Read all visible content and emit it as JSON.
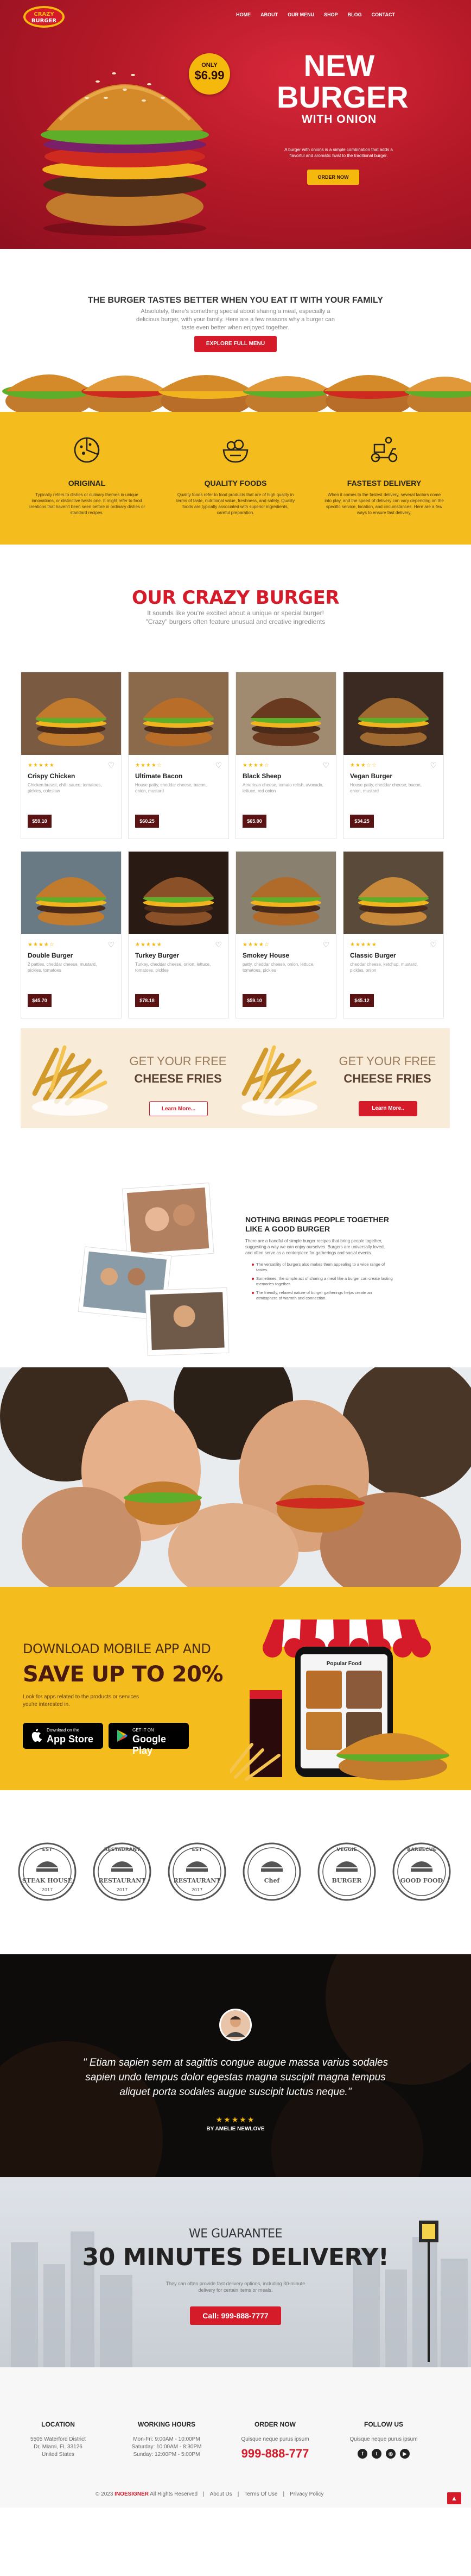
{
  "brand": {
    "logo_text_1": "CRAZY",
    "logo_text_2": "BURGER"
  },
  "nav": [
    {
      "label": "HOME"
    },
    {
      "label": "ABOUT"
    },
    {
      "label": "OUR MENU"
    },
    {
      "label": "SHOP"
    },
    {
      "label": "BLOG"
    },
    {
      "label": "CONTACT"
    }
  ],
  "hero": {
    "price_label": "ONLY",
    "price": "$6.99",
    "title_1": "NEW",
    "title_2": "BURGER",
    "title_3": "WITH ONION",
    "description": "A burger with onions is a simple combination that adds a flavorful and aromatic twist to the traditional burger.",
    "button": "ORDER NOW"
  },
  "intro": {
    "heading": "THE BURGER TASTES BETTER WHEN YOU EAT IT WITH YOUR FAMILY",
    "text": "Absolutely, there's something special about sharing a meal, especially a delicious burger, with your family. Here are a few reasons why a burger can taste even better when enjoyed together.",
    "button": "EXPLORE FULL MENU"
  },
  "features": [
    {
      "icon": "pizza-slice-icon",
      "title": "ORIGINAL",
      "text": "Typically refers to dishes or culinary themes in unique innovations, or distinctive twists one. It might refer to food creations that haven't been seen before in ordinary dishes or standard recipes."
    },
    {
      "icon": "salad-bowl-icon",
      "title": "QUALITY FOODS",
      "text": "Quality foods refer to food products that are of high quality in terms of taste, nutritional value, freshness, and safety. Quality foods are typically associated with superior ingredients, careful preparation."
    },
    {
      "icon": "delivery-scooter-icon",
      "title": "FASTEST DELIVERY",
      "text": "When it comes to the fastest delivery, several factors come into play, and the speed of delivery can vary depending on the specific service, location, and circumstances. Here are a few ways to ensure fast delivery."
    }
  ],
  "menu": {
    "title": "OUR CRAZY BURGER",
    "subtitle_1": "It sounds like you're excited about a unique or special burger!",
    "subtitle_2": "\"Crazy\" burgers often feature unusual and creative ingredients",
    "items": [
      {
        "name": "Crispy Chicken",
        "desc": "Chicken breast, chilli sauce, tomatoes, pickles, coleslaw",
        "price": "$59.10",
        "stars": "★★★★★"
      },
      {
        "name": "Ultimate Bacon",
        "desc": "House patty, cheddar cheese, bacon, onion, mustard",
        "price": "$60.25",
        "stars": "★★★★☆"
      },
      {
        "name": "Black Sheep",
        "desc": "American cheese, tomato relish, avocado, lettuce, red onion",
        "price": "$65.00",
        "stars": "★★★★☆"
      },
      {
        "name": "Vegan Burger",
        "desc": "House patty, cheddar cheese, bacon, onion, mustard",
        "price": "$34.25",
        "stars": "★★★☆☆"
      },
      {
        "name": "Double Burger",
        "desc": "2 patties, cheddar cheese, mustard, pickles, tomatoes",
        "price": "$45.70",
        "stars": "★★★★☆"
      },
      {
        "name": "Turkey Burger",
        "desc": "Turkey, cheddar cheese, onion, lettuce, tomatoes, pickles",
        "price": "$78.18",
        "stars": "★★★★★"
      },
      {
        "name": "Smokey House",
        "desc": "patty, cheddar cheese, onion, lettuce, tomatoes, pickles",
        "price": "$59.10",
        "stars": "★★★★☆"
      },
      {
        "name": "Classic Burger",
        "desc": "cheddar cheese, ketchup, mustard, pickles, onion",
        "price": "$45.12",
        "stars": "★★★★★"
      }
    ]
  },
  "promo": [
    {
      "line_1": "GET YOUR FREE",
      "line_2": "CHEESE FRIES",
      "button": "Learn More..."
    },
    {
      "line_1": "GET YOUR FREE",
      "line_2": "CHEESE FRIES",
      "button": "Learn More.."
    }
  ],
  "story": {
    "title": "NOTHING BRINGS PEOPLE TOGETHER LIKE A GOOD BURGER",
    "text": "There are a handful of simple burger recipes that bring people together, suggesting a way we can enjoy ourselves. Burgers are universally loved, and often serve as a centerpiece for gatherings and social events.",
    "bullets": [
      "The versatility of burgers also makes them appealing to a wide range of tastes.",
      "Sometimes, the simple act of sharing a meal like a burger can create lasting memories together.",
      "The friendly, relaxed nature of burger gatherings helps create an atmosphere of warmth and connection."
    ]
  },
  "app": {
    "line_1": "DOWNLOAD MOBILE APP AND",
    "line_2": "SAVE UP TO 20%",
    "text": "Look for apps related to the products or services you're interested in.",
    "app_store_small": "Download on the",
    "app_store": "App Store",
    "play_small": "GET IT ON",
    "play": "Google Play",
    "phone_title": "Popular Food"
  },
  "logos": [
    {
      "top": "EST",
      "main": "STEAK HOUSE",
      "year": "2017"
    },
    {
      "top": "RESTAURANT",
      "main": "RESTAURANT",
      "year": "2017"
    },
    {
      "top": "EST",
      "main": "RESTAURANT",
      "year": "2017"
    },
    {
      "top": "",
      "main": "Chef",
      "year": ""
    },
    {
      "top": "VEGGIE",
      "main": "BURGER",
      "year": ""
    },
    {
      "top": "BARBECUE",
      "main": "GOOD FOOD",
      "year": ""
    }
  ],
  "testimonial": {
    "quote": "\" Etiam sapien sem at sagittis congue augue massa varius sodales sapien undo tempus dolor egestas magna suscipit magna tempus aliquet porta sodales augue suscipit luctus neque.\"",
    "stars": "★★★★★",
    "author": "BY AMELIE NEWLOVE"
  },
  "guarantee": {
    "line_1": "WE GUARANTEE",
    "line_2": "30 MINUTES DELIVERY!",
    "text": "They can often provide fast delivery options, including 30-minute delivery for certain items or meals.",
    "button": "Call: 999-888-7777"
  },
  "footer": {
    "location_title": "LOCATION",
    "location": [
      "5505 Waterford District",
      "Dr, Miami, FL 33126",
      "United States"
    ],
    "hours_title": "WORKING HOURS",
    "hours": [
      "Mon-Fri: 9:00AM - 10:00PM",
      "Saturday: 10:00AM - 8:30PM",
      "Sunday: 12:00PM - 5:00PM"
    ],
    "order_title": "ORDER NOW",
    "order_text": "Quisque neque purus ipsum",
    "order_phone": "999-888-777",
    "follow_title": "FOLLOW US",
    "follow_text": "Quisque neque purus ipsum",
    "copyright": "© 2023 ",
    "copyright_brand": "INOESIGNER",
    "copyright_rest": " All Rights Reserved",
    "links": [
      "About Us",
      "Terms Of Use",
      "Privacy Policy"
    ]
  },
  "colors": {
    "red": "#d51b29",
    "yellow": "#f4bd1d",
    "dark_red": "#8e1020",
    "brown": "#5a1212"
  }
}
